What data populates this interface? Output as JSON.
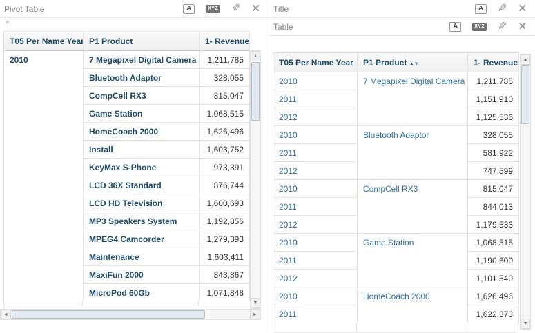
{
  "pivot_panel": {
    "title": "Pivot Table",
    "expander_glyph": "»",
    "toolbar": {
      "format": "A",
      "rename": "XYZ",
      "edit_glyph": "✎",
      "close_glyph": "✕"
    },
    "columns": {
      "year": "T05 Per Name Year",
      "product": "P1 Product",
      "revenue": "1- Revenue"
    },
    "year": "2010",
    "rows": [
      {
        "product": "7 Megapixel Digital Camera",
        "revenue": "1,211,785"
      },
      {
        "product": "Bluetooth Adaptor",
        "revenue": "328,055"
      },
      {
        "product": "CompCell RX3",
        "revenue": "815,047"
      },
      {
        "product": "Game Station",
        "revenue": "1,068,515"
      },
      {
        "product": "HomeCoach 2000",
        "revenue": "1,626,496"
      },
      {
        "product": "Install",
        "revenue": "1,603,752"
      },
      {
        "product": "KeyMax S-Phone",
        "revenue": "973,391"
      },
      {
        "product": "LCD 36X Standard",
        "revenue": "876,744"
      },
      {
        "product": "LCD HD Television",
        "revenue": "1,600,693"
      },
      {
        "product": "MP3 Speakers System",
        "revenue": "1,192,856"
      },
      {
        "product": "MPEG4 Camcorder",
        "revenue": "1,279,393"
      },
      {
        "product": "Maintenance",
        "revenue": "1,603,411"
      },
      {
        "product": "MaxiFun 2000",
        "revenue": "843,867"
      },
      {
        "product": "MicroPod 60Gb",
        "revenue": "1,071,848"
      }
    ]
  },
  "title_panel": {
    "title": "Title",
    "toolbar": {
      "format": "A",
      "edit_glyph": "✎",
      "close_glyph": "✕"
    }
  },
  "table_panel": {
    "title": "Table",
    "toolbar": {
      "format": "A",
      "rename": "XYZ",
      "edit_glyph": "✎",
      "close_glyph": "✕"
    },
    "columns": {
      "year": "T05 Per Name Year",
      "product": "P1 Product",
      "revenue": "1- Revenue"
    },
    "sort_asc_glyph": "▲",
    "sort_desc_glyph": "▼",
    "rows": [
      {
        "year": "2010",
        "product": "7 Megapixel Digital Camera",
        "revenue": "1,211,785"
      },
      {
        "year": "2011",
        "product": "",
        "revenue": "1,151,910"
      },
      {
        "year": "2012",
        "product": "",
        "revenue": "1,125,536"
      },
      {
        "year": "2010",
        "product": "Bluetooth Adaptor",
        "revenue": "328,055"
      },
      {
        "year": "2011",
        "product": "",
        "revenue": "581,922"
      },
      {
        "year": "2012",
        "product": "",
        "revenue": "747,599"
      },
      {
        "year": "2010",
        "product": "CompCell RX3",
        "revenue": "815,047"
      },
      {
        "year": "2011",
        "product": "",
        "revenue": "844,013"
      },
      {
        "year": "2012",
        "product": "",
        "revenue": "1,179,533"
      },
      {
        "year": "2010",
        "product": "Game Station",
        "revenue": "1,068,515"
      },
      {
        "year": "2011",
        "product": "",
        "revenue": "1,190,600"
      },
      {
        "year": "2012",
        "product": "",
        "revenue": "1,101,540"
      },
      {
        "year": "2010",
        "product": "HomeCoach 2000",
        "revenue": "1,626,496"
      },
      {
        "year": "2011",
        "product": "",
        "revenue": "1,622,373"
      }
    ]
  },
  "scrollbar": {
    "up_glyph": "▲",
    "down_glyph": "▼",
    "left_glyph": "◄",
    "right_glyph": "►"
  },
  "colors": {
    "link_blue": "#2e6e9e",
    "header_navy": "#1d4a66",
    "panel_title_gray": "#808080"
  }
}
